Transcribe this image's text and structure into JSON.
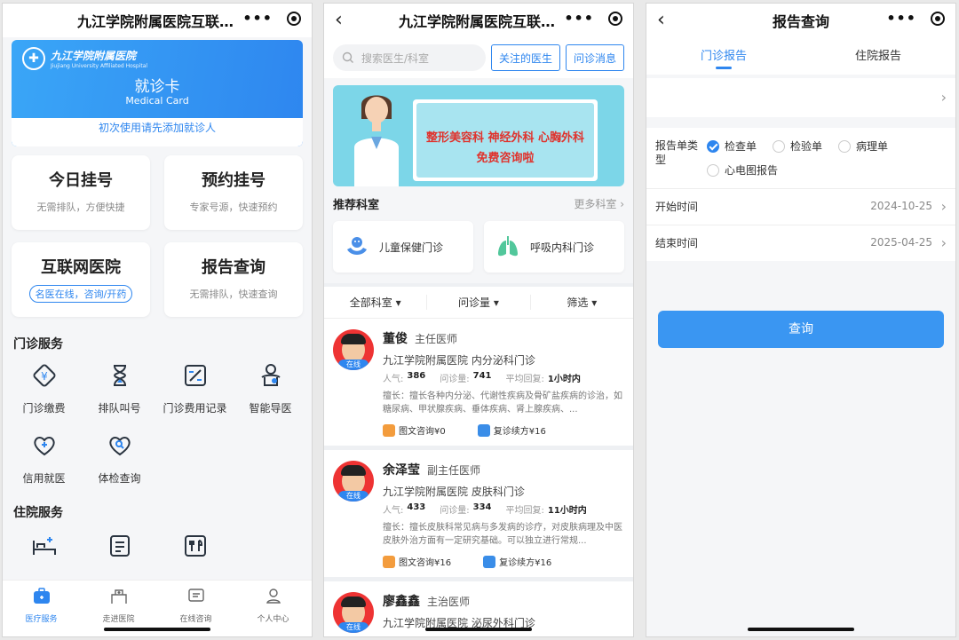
{
  "screen1": {
    "nav_title": "九江学院附属医院互联网医院",
    "card": {
      "hospital_cn": "九江学院附属医院",
      "hospital_en": "Jiujiang University Affiliated Hospital",
      "title": "就诊卡",
      "subtitle": "Medical Card",
      "hint": "初次使用请先添加就诊人"
    },
    "tiles": [
      {
        "title": "今日挂号",
        "sub": "无需排队，方便快捷"
      },
      {
        "title": "预约挂号",
        "sub": "专家号源，快速预约"
      },
      {
        "title": "互联网医院",
        "tag": "名医在线，咨询/开药"
      },
      {
        "title": "报告查询",
        "sub": "无需排队，快速查询"
      }
    ],
    "outpatient_title": "门诊服务",
    "outpatient_services": [
      "门诊缴费",
      "排队叫号",
      "门诊费用记录",
      "智能导医",
      "信用就医",
      "体检查询"
    ],
    "inpatient_title": "住院服务",
    "tabbar": [
      "医疗服务",
      "走进医院",
      "在线咨询",
      "个人中心"
    ],
    "accent": "#2e86ef"
  },
  "screen2": {
    "nav_title": "九江学院附属医院互联网医院",
    "search_placeholder": "搜索医生/科室",
    "btn_follow": "关注的医生",
    "btn_messages": "问诊消息",
    "banner_line1": "整形美容科 神经外科 心胸外科",
    "banner_line2": "免费咨询啦",
    "recommend_title": "推荐科室",
    "more_depts": "更多科室",
    "depts": [
      "儿童保健门诊",
      "呼吸内科门诊"
    ],
    "filters": [
      "全部科室",
      "问诊量",
      "筛选"
    ],
    "labels": {
      "popularity": "人气:",
      "consults": "问诊量:",
      "avg_reply": "平均回复:",
      "online": "在线"
    },
    "doctors": [
      {
        "name": "董俊",
        "title": "主任医师",
        "hospital": "九江学院附属医院 内分泌科门诊",
        "popularity": "386",
        "consults": "741",
        "reply": "1小时内",
        "skill": "擅长：擅长各种内分泌、代谢性疾病及骨矿盐疾病的诊治，如糖尿病、甲状腺疾病、垂体疾病、肾上腺疾病、...",
        "action1": "图文咨询¥0",
        "action2": "复诊续方¥16"
      },
      {
        "name": "余泽莹",
        "title": "副主任医师",
        "hospital": "九江学院附属医院 皮肤科门诊",
        "popularity": "433",
        "consults": "334",
        "reply": "11小时内",
        "skill": "擅长：擅长皮肤科常见病与多发病的诊疗，对皮肤病理及中医皮肤外治方面有一定研究基础。可以独立进行常规...",
        "action1": "图文咨询¥16",
        "action2": "复诊续方¥16"
      },
      {
        "name": "廖鑫鑫",
        "title": "主治医师",
        "hospital": "九江学院附属医院 泌尿外科门诊"
      }
    ]
  },
  "screen3": {
    "nav_title": "报告查询",
    "tabs": [
      "门诊报告",
      "住院报告"
    ],
    "type_label": "报告单类型",
    "types": [
      {
        "label": "检查单",
        "checked": true
      },
      {
        "label": "检验单",
        "checked": false
      },
      {
        "label": "病理单",
        "checked": false
      },
      {
        "label": "心电图报告",
        "checked": false
      }
    ],
    "start_label": "开始时间",
    "start_value": "2024-10-25",
    "end_label": "结束时间",
    "end_value": "2025-04-25",
    "query_button": "查询"
  }
}
